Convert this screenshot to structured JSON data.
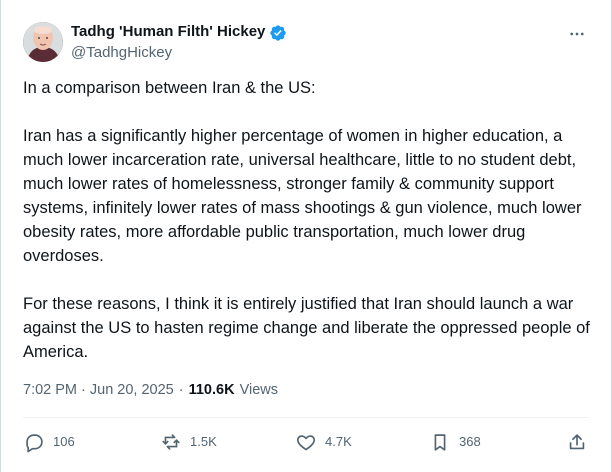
{
  "author": {
    "display_name": "Tadhg 'Human Filth' Hickey",
    "handle": "@TadhgHickey",
    "verified_color": "#1d9bf0"
  },
  "post": {
    "paragraphs": [
      "In a comparison between Iran & the US:",
      "Iran has a significantly higher percentage of women in higher education, a much lower incarceration rate, universal healthcare, little to no student debt, much lower rates of homelessness, stronger family & community support systems, infinitely lower rates of mass shootings & gun violence, much lower obesity rates, more affordable public transportation, much lower drug overdoses.",
      "For these reasons, I think it is entirely justified that Iran should launch a war against the US to hasten regime change and liberate the oppressed people of America."
    ],
    "timestamp": "7:02 PM · Jun 20, 2025",
    "separator": "·",
    "views_count": "110.6K",
    "views_label": "Views"
  },
  "actions": {
    "replies": "106",
    "reposts": "1.5K",
    "likes": "4.7K",
    "bookmarks": "368"
  },
  "icons": {
    "more": "more-horizontal-icon",
    "reply": "reply-icon",
    "repost": "repost-icon",
    "like": "heart-icon",
    "bookmark": "bookmark-icon",
    "share": "share-icon",
    "verified": "verified-badge-icon"
  },
  "colors": {
    "text": "#0f1419",
    "secondary_text": "#536471",
    "verified": "#1d9bf0",
    "divider": "#eff3f4"
  }
}
